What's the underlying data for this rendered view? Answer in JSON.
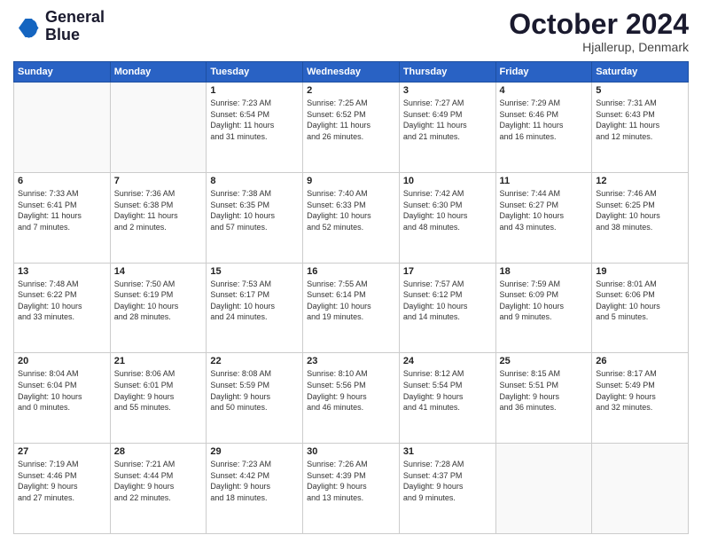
{
  "header": {
    "logo_line1": "General",
    "logo_line2": "Blue",
    "month": "October 2024",
    "location": "Hjallerup, Denmark"
  },
  "weekdays": [
    "Sunday",
    "Monday",
    "Tuesday",
    "Wednesday",
    "Thursday",
    "Friday",
    "Saturday"
  ],
  "weeks": [
    [
      {
        "day": "",
        "info": ""
      },
      {
        "day": "",
        "info": ""
      },
      {
        "day": "1",
        "info": "Sunrise: 7:23 AM\nSunset: 6:54 PM\nDaylight: 11 hours\nand 31 minutes."
      },
      {
        "day": "2",
        "info": "Sunrise: 7:25 AM\nSunset: 6:52 PM\nDaylight: 11 hours\nand 26 minutes."
      },
      {
        "day": "3",
        "info": "Sunrise: 7:27 AM\nSunset: 6:49 PM\nDaylight: 11 hours\nand 21 minutes."
      },
      {
        "day": "4",
        "info": "Sunrise: 7:29 AM\nSunset: 6:46 PM\nDaylight: 11 hours\nand 16 minutes."
      },
      {
        "day": "5",
        "info": "Sunrise: 7:31 AM\nSunset: 6:43 PM\nDaylight: 11 hours\nand 12 minutes."
      }
    ],
    [
      {
        "day": "6",
        "info": "Sunrise: 7:33 AM\nSunset: 6:41 PM\nDaylight: 11 hours\nand 7 minutes."
      },
      {
        "day": "7",
        "info": "Sunrise: 7:36 AM\nSunset: 6:38 PM\nDaylight: 11 hours\nand 2 minutes."
      },
      {
        "day": "8",
        "info": "Sunrise: 7:38 AM\nSunset: 6:35 PM\nDaylight: 10 hours\nand 57 minutes."
      },
      {
        "day": "9",
        "info": "Sunrise: 7:40 AM\nSunset: 6:33 PM\nDaylight: 10 hours\nand 52 minutes."
      },
      {
        "day": "10",
        "info": "Sunrise: 7:42 AM\nSunset: 6:30 PM\nDaylight: 10 hours\nand 48 minutes."
      },
      {
        "day": "11",
        "info": "Sunrise: 7:44 AM\nSunset: 6:27 PM\nDaylight: 10 hours\nand 43 minutes."
      },
      {
        "day": "12",
        "info": "Sunrise: 7:46 AM\nSunset: 6:25 PM\nDaylight: 10 hours\nand 38 minutes."
      }
    ],
    [
      {
        "day": "13",
        "info": "Sunrise: 7:48 AM\nSunset: 6:22 PM\nDaylight: 10 hours\nand 33 minutes."
      },
      {
        "day": "14",
        "info": "Sunrise: 7:50 AM\nSunset: 6:19 PM\nDaylight: 10 hours\nand 28 minutes."
      },
      {
        "day": "15",
        "info": "Sunrise: 7:53 AM\nSunset: 6:17 PM\nDaylight: 10 hours\nand 24 minutes."
      },
      {
        "day": "16",
        "info": "Sunrise: 7:55 AM\nSunset: 6:14 PM\nDaylight: 10 hours\nand 19 minutes."
      },
      {
        "day": "17",
        "info": "Sunrise: 7:57 AM\nSunset: 6:12 PM\nDaylight: 10 hours\nand 14 minutes."
      },
      {
        "day": "18",
        "info": "Sunrise: 7:59 AM\nSunset: 6:09 PM\nDaylight: 10 hours\nand 9 minutes."
      },
      {
        "day": "19",
        "info": "Sunrise: 8:01 AM\nSunset: 6:06 PM\nDaylight: 10 hours\nand 5 minutes."
      }
    ],
    [
      {
        "day": "20",
        "info": "Sunrise: 8:04 AM\nSunset: 6:04 PM\nDaylight: 10 hours\nand 0 minutes."
      },
      {
        "day": "21",
        "info": "Sunrise: 8:06 AM\nSunset: 6:01 PM\nDaylight: 9 hours\nand 55 minutes."
      },
      {
        "day": "22",
        "info": "Sunrise: 8:08 AM\nSunset: 5:59 PM\nDaylight: 9 hours\nand 50 minutes."
      },
      {
        "day": "23",
        "info": "Sunrise: 8:10 AM\nSunset: 5:56 PM\nDaylight: 9 hours\nand 46 minutes."
      },
      {
        "day": "24",
        "info": "Sunrise: 8:12 AM\nSunset: 5:54 PM\nDaylight: 9 hours\nand 41 minutes."
      },
      {
        "day": "25",
        "info": "Sunrise: 8:15 AM\nSunset: 5:51 PM\nDaylight: 9 hours\nand 36 minutes."
      },
      {
        "day": "26",
        "info": "Sunrise: 8:17 AM\nSunset: 5:49 PM\nDaylight: 9 hours\nand 32 minutes."
      }
    ],
    [
      {
        "day": "27",
        "info": "Sunrise: 7:19 AM\nSunset: 4:46 PM\nDaylight: 9 hours\nand 27 minutes."
      },
      {
        "day": "28",
        "info": "Sunrise: 7:21 AM\nSunset: 4:44 PM\nDaylight: 9 hours\nand 22 minutes."
      },
      {
        "day": "29",
        "info": "Sunrise: 7:23 AM\nSunset: 4:42 PM\nDaylight: 9 hours\nand 18 minutes."
      },
      {
        "day": "30",
        "info": "Sunrise: 7:26 AM\nSunset: 4:39 PM\nDaylight: 9 hours\nand 13 minutes."
      },
      {
        "day": "31",
        "info": "Sunrise: 7:28 AM\nSunset: 4:37 PM\nDaylight: 9 hours\nand 9 minutes."
      },
      {
        "day": "",
        "info": ""
      },
      {
        "day": "",
        "info": ""
      }
    ]
  ]
}
